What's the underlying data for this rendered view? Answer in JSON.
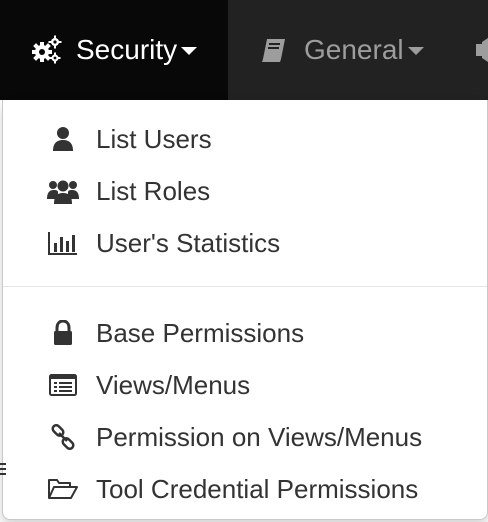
{
  "navbar": {
    "security": {
      "label": "Security",
      "icon": "gears-icon"
    },
    "general": {
      "label": "General",
      "icon": "book-icon"
    },
    "next": {
      "icon": "megaphone-icon"
    }
  },
  "dropdown": {
    "items": [
      {
        "label": "List Users",
        "icon": "user-icon"
      },
      {
        "label": "List Roles",
        "icon": "users-icon"
      },
      {
        "label": "User's Statistics",
        "icon": "bar-chart-icon"
      },
      {
        "label": "Base Permissions",
        "icon": "lock-icon"
      },
      {
        "label": "Views/Menus",
        "icon": "list-alt-icon"
      },
      {
        "label": "Permission on Views/Menus",
        "icon": "link-icon"
      },
      {
        "label": "Tool Credential Permissions",
        "icon": "folder-open-icon"
      }
    ]
  },
  "colors": {
    "navbar_bg": "#222222",
    "active_bg": "#080808",
    "active_text": "#ffffff",
    "inactive_text": "#9d9d9d",
    "menu_text": "#333333"
  }
}
